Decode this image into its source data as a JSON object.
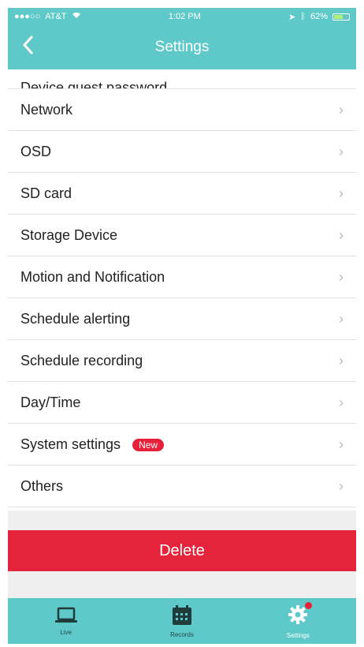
{
  "status_bar": {
    "carrier": "AT&T",
    "time": "1:02 PM",
    "battery": "62%",
    "battery_level": 0.62
  },
  "nav": {
    "title": "Settings",
    "back_icon": "chevron-left-icon"
  },
  "settings": {
    "partial_item": "Device guest password",
    "items": [
      "Network",
      "OSD",
      "SD card",
      "Storage Device",
      "Motion and Notification",
      "Schedule alerting",
      "Schedule recording",
      "Day/Time",
      "System settings",
      "Others"
    ],
    "new_badge": "New",
    "chevron": "›"
  },
  "actions": {
    "delete_label": "Delete"
  },
  "tab_bar": {
    "tabs": [
      {
        "label": "Live",
        "icon": "laptop-icon"
      },
      {
        "label": "Records",
        "icon": "calendar-icon"
      },
      {
        "label": "Settings",
        "icon": "gear-icon"
      }
    ],
    "active": "Settings"
  },
  "colors": {
    "accent": "#5fc9c9",
    "danger": "#e5243b"
  }
}
